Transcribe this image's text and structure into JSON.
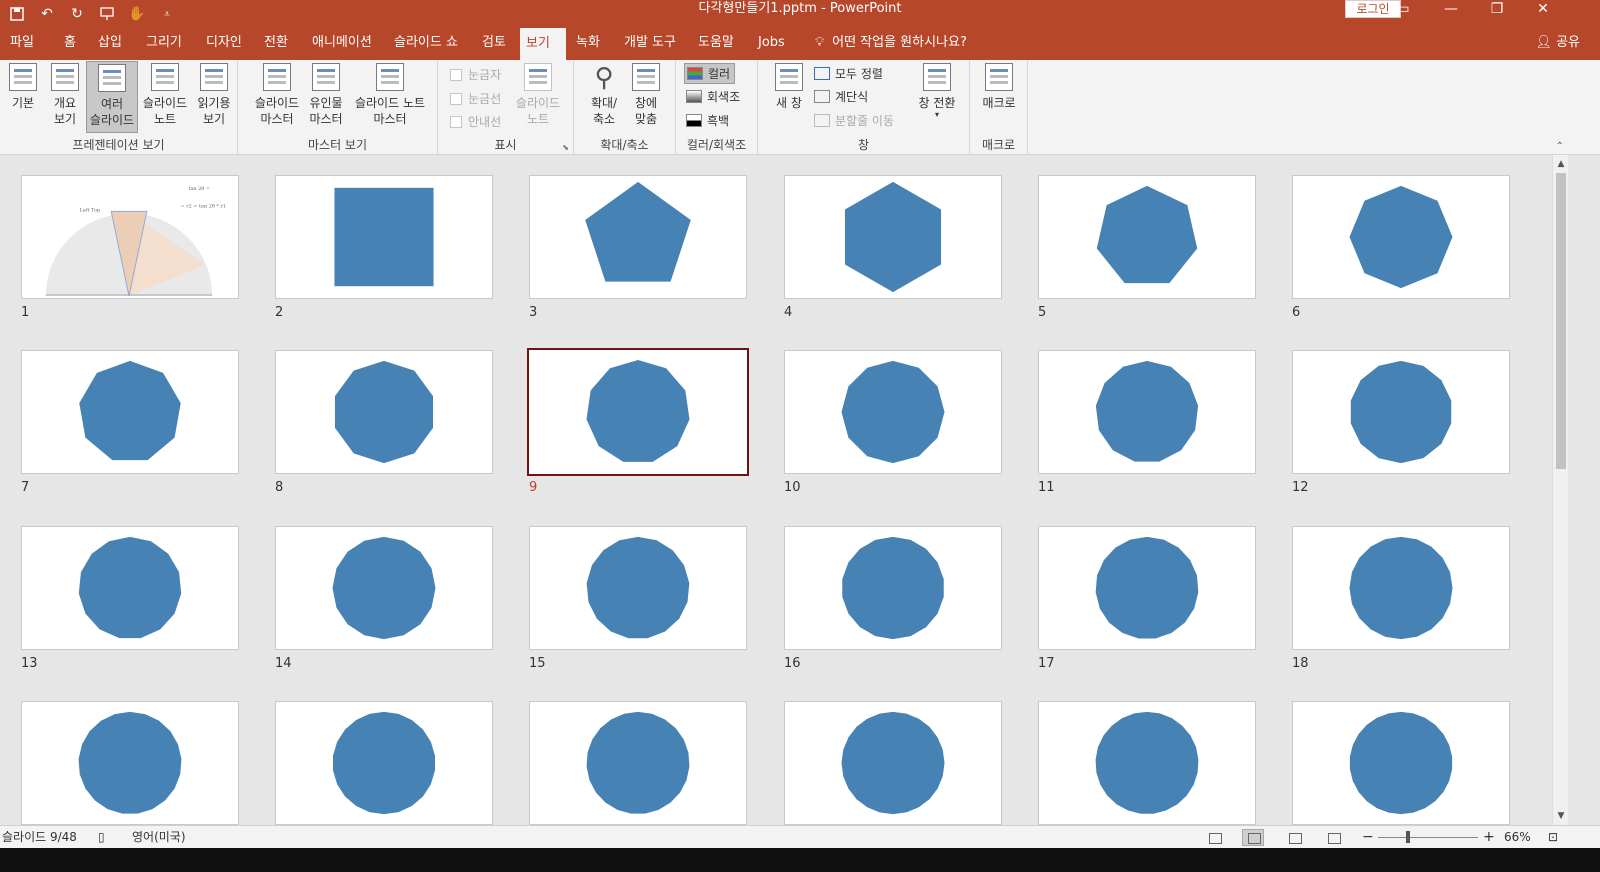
{
  "titlebar": {
    "title": "다각형만들기1.pptm  -  PowerPoint",
    "login": "로그인",
    "qat_icons": [
      "save-icon",
      "undo-icon",
      "redo-icon",
      "present-from-start-icon",
      "touch-mode-icon",
      "customize-qat-icon"
    ]
  },
  "tabs": [
    "파일",
    "홈",
    "삽입",
    "그리기",
    "디자인",
    "전환",
    "애니메이션",
    "슬라이드 쇼",
    "검토",
    "보기",
    "녹화",
    "개발 도구",
    "도움말",
    "Jobs"
  ],
  "active_tab": "보기",
  "tellme": "어떤 작업을 원하시나요?",
  "share": "공유",
  "ribbon": {
    "groups": {
      "presentation_views": "프레젠테이션 보기",
      "master_views": "마스터 보기",
      "show": "표시",
      "zoom": "확대/축소",
      "color": "컬러/회색조",
      "window": "창",
      "macros": "매크로"
    },
    "presentation_views": [
      {
        "line1": "기본",
        "line2": ""
      },
      {
        "line1": "개요",
        "line2": "보기"
      },
      {
        "line1": "여러",
        "line2": "슬라이드"
      },
      {
        "line1": "슬라이드",
        "line2": "노트"
      },
      {
        "line1": "읽기용",
        "line2": "보기"
      }
    ],
    "master_views": [
      {
        "line1": "슬라이드",
        "line2": "마스터"
      },
      {
        "line1": "유인물",
        "line2": "마스터"
      },
      {
        "line1": "슬라이드 노트",
        "line2": "마스터"
      }
    ],
    "show": {
      "ruler": "눈금자",
      "gridlines": "눈금선",
      "guides": "안내선",
      "notes_line1": "슬라이드",
      "notes_line2": "노트"
    },
    "zoom": [
      {
        "line1": "확대/",
        "line2": "축소"
      },
      {
        "line1": "창에",
        "line2": "맞춤"
      }
    ],
    "color": {
      "color": "컬러",
      "grayscale": "회색조",
      "bw": "흑백"
    },
    "window": {
      "new_window": "새 창",
      "arrange_all": "모두 정렬",
      "cascade": "계단식",
      "move_split": "분할줄 이동",
      "switch_line1": "창 전환",
      "switch_line2": "▾"
    },
    "macros": "매크로"
  },
  "slides": [
    {
      "num": "1",
      "kind": "diagram",
      "sides": 0
    },
    {
      "num": "2",
      "kind": "square",
      "sides": 4
    },
    {
      "num": "3",
      "kind": "polygon",
      "sides": 5
    },
    {
      "num": "4",
      "kind": "polygon",
      "sides": 6
    },
    {
      "num": "5",
      "kind": "polygon",
      "sides": 7
    },
    {
      "num": "6",
      "kind": "polygon",
      "sides": 8
    },
    {
      "num": "7",
      "kind": "polygon",
      "sides": 9
    },
    {
      "num": "8",
      "kind": "polygon",
      "sides": 10
    },
    {
      "num": "9",
      "kind": "polygon",
      "sides": 11
    },
    {
      "num": "10",
      "kind": "polygon",
      "sides": 12
    },
    {
      "num": "11",
      "kind": "polygon",
      "sides": 13
    },
    {
      "num": "12",
      "kind": "polygon",
      "sides": 14
    },
    {
      "num": "13",
      "kind": "polygon",
      "sides": 15
    },
    {
      "num": "14",
      "kind": "polygon",
      "sides": 16
    },
    {
      "num": "15",
      "kind": "polygon",
      "sides": 17
    },
    {
      "num": "16",
      "kind": "polygon",
      "sides": 18
    },
    {
      "num": "17",
      "kind": "polygon",
      "sides": 19
    },
    {
      "num": "18",
      "kind": "polygon",
      "sides": 20
    },
    {
      "num": "",
      "kind": "polygon",
      "sides": 21
    },
    {
      "num": "",
      "kind": "polygon",
      "sides": 22
    },
    {
      "num": "",
      "kind": "polygon",
      "sides": 23
    },
    {
      "num": "",
      "kind": "polygon",
      "sides": 24
    },
    {
      "num": "",
      "kind": "polygon",
      "sides": 25
    },
    {
      "num": "",
      "kind": "polygon",
      "sides": 26
    }
  ],
  "selected_slide": "9",
  "slide1_text": {
    "formula1": "tan 2θ = ",
    "formula2": "= r2 = tan 2θ * r1",
    "label": "Left Top"
  },
  "colors": {
    "accent": "#b7472a",
    "shape_fill": "#4682b4",
    "selected_border": "#6e1212"
  },
  "status": {
    "slide_counter": "슬라이드 9/48",
    "language": "영어(미국)",
    "zoom": "66%"
  }
}
